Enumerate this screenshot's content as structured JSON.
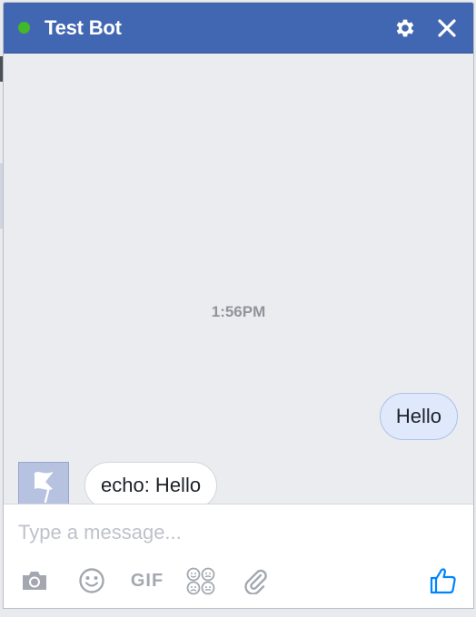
{
  "header": {
    "title": "Test Bot",
    "online_color": "#42b72a",
    "settings_icon": "gear-icon",
    "close_icon": "close-icon"
  },
  "conversation": {
    "timestamp": "1:56PM",
    "messages": [
      {
        "direction": "outgoing",
        "text": "Hello"
      },
      {
        "direction": "incoming",
        "text": "echo: Hello",
        "avatar_icon": "flag-icon"
      }
    ]
  },
  "composer": {
    "placeholder": "Type a message...",
    "value": "",
    "tools": [
      {
        "name": "camera-icon"
      },
      {
        "name": "emoji-icon"
      },
      {
        "name": "gif-icon",
        "label": "GIF"
      },
      {
        "name": "stickers-icon"
      },
      {
        "name": "attachment-icon"
      }
    ],
    "like_icon": "thumbs-up-icon"
  },
  "colors": {
    "header_bg": "#4267b2",
    "outgoing_bubble": "#dfe9fb",
    "incoming_bubble": "#ffffff",
    "accent": "#0084ff"
  }
}
